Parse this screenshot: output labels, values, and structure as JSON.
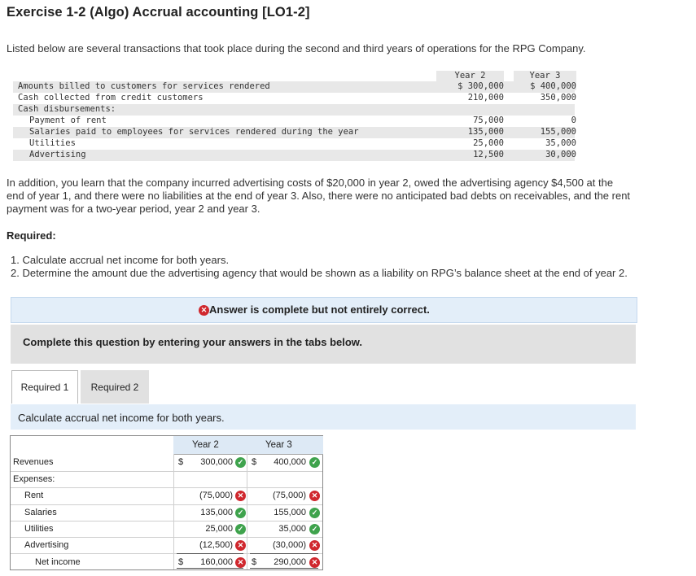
{
  "title": "Exercise 1-2 (Algo) Accrual accounting [LO1-2]",
  "intro": "Listed below are several transactions that took place during the second and third years of operations for the RPG Company.",
  "transactions": {
    "headers": {
      "year2": "Year 2",
      "year3": "Year 3"
    },
    "rows": [
      {
        "label": "Amounts billed to customers for services rendered",
        "y2": "$ 300,000",
        "y3": "$ 400,000"
      },
      {
        "label": "Cash collected from credit customers",
        "y2": "210,000",
        "y3": "350,000"
      },
      {
        "label": "Cash disbursements:",
        "y2": "",
        "y3": ""
      },
      {
        "label": "Payment of rent",
        "y2": "75,000",
        "y3": "0"
      },
      {
        "label": "Salaries paid to employees for services rendered during the year",
        "y2": "135,000",
        "y3": "155,000"
      },
      {
        "label": "Utilities",
        "y2": "25,000",
        "y3": "35,000"
      },
      {
        "label": "Advertising",
        "y2": "12,500",
        "y3": "30,000"
      }
    ]
  },
  "addition_line1": "In addition, you learn that the company incurred advertising costs of $20,000 in year 2, owed the advertising agency $4,500 at the",
  "addition_line2": "end of year 1, and there were no liabilities at the end of year 3. Also, there were no anticipated bad debts on receivables, and the rent",
  "addition_line3": "payment was for a two-year period, year 2 and year 3.",
  "required_heading": "Required:",
  "req1": "1. Calculate accrual net income for both years.",
  "req2": "2. Determine the amount due the advertising agency that would be shown as a liability on RPG’s balance sheet at the end of year 2.",
  "answer_banner": "Answer is complete but not entirely correct.",
  "complete_banner": "Complete this question by entering your answers in the tabs below.",
  "tabs": [
    {
      "label": "Required 1"
    },
    {
      "label": "Required 2"
    }
  ],
  "instruction": "Calculate accrual net income for both years.",
  "grid": {
    "header_y2": "Year 2",
    "header_y3": "Year 3",
    "dollar": "$",
    "revenues": {
      "label": "Revenues",
      "y2": "300,000",
      "y3": "400,000"
    },
    "expenses_label": "Expenses:",
    "rent": {
      "label": "Rent",
      "y2": "(75,000)",
      "y3": "(75,000)"
    },
    "salaries": {
      "label": "Salaries",
      "y2": "135,000",
      "y3": "155,000"
    },
    "utilities": {
      "label": "Utilities",
      "y2": "25,000",
      "y3": "35,000"
    },
    "advertising": {
      "label": "Advertising",
      "y2": "(12,500)",
      "y3": "(30,000)"
    },
    "net_income": {
      "label": "Net income",
      "y2": "160,000",
      "y3": "290,000"
    }
  },
  "icons": {
    "correct": "check-icon",
    "incorrect": "x-icon"
  },
  "colors": {
    "correct": "#3fa34d",
    "incorrect": "#d0282e",
    "banner_blue": "#e3eef9",
    "banner_gray": "#e1e1e1"
  }
}
